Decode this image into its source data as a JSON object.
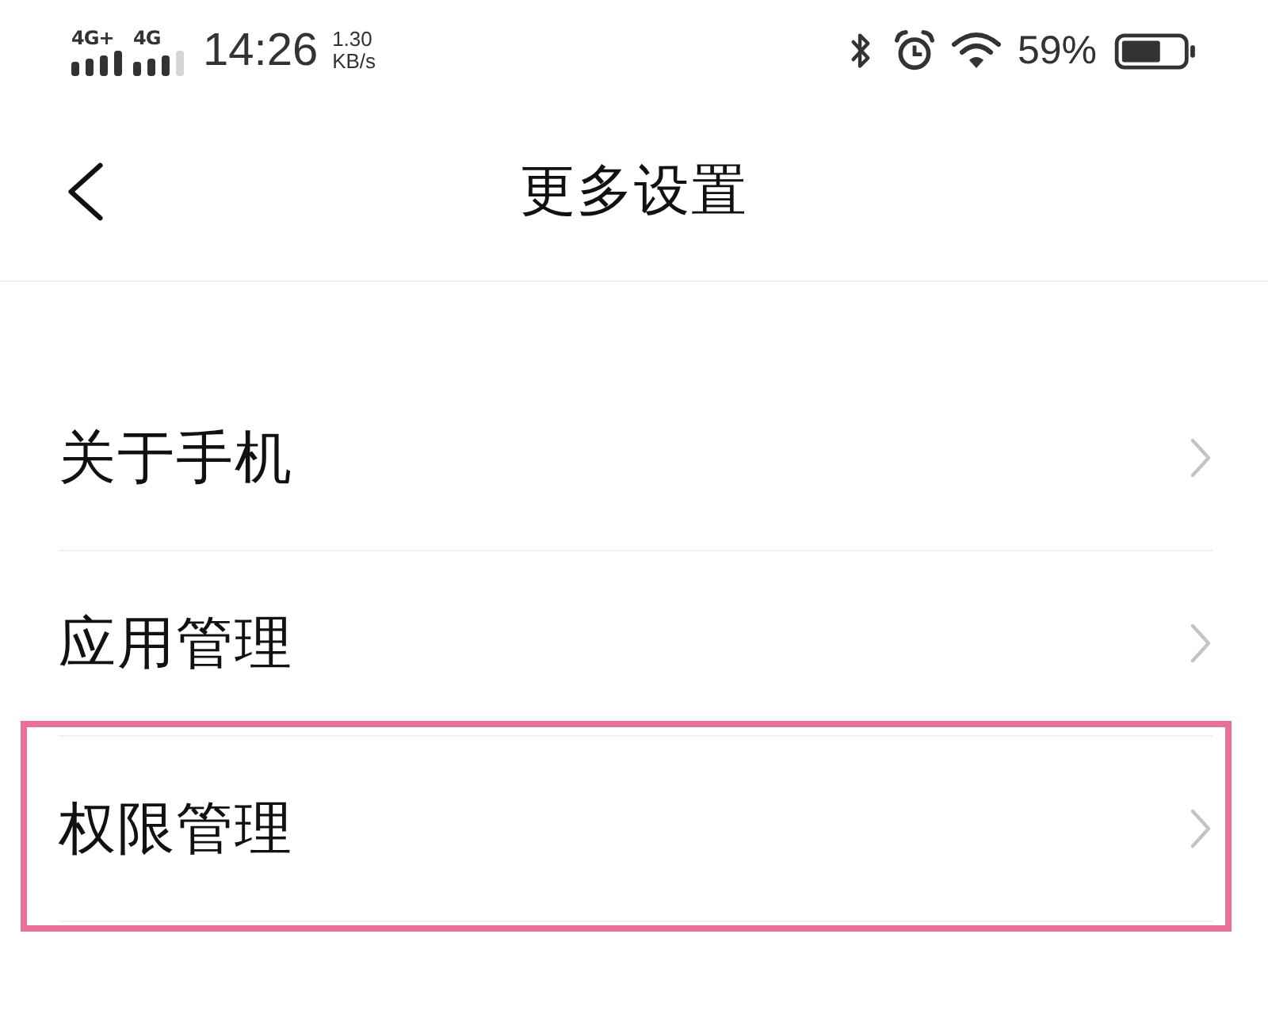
{
  "status_bar": {
    "networks": [
      {
        "label": "4G+"
      },
      {
        "label": "4G"
      }
    ],
    "time": "14:26",
    "speed": {
      "value": "1.30",
      "unit": "KB/s"
    },
    "battery_percent": "59%"
  },
  "header": {
    "title": "更多设置"
  },
  "items": [
    {
      "label": "关于手机",
      "highlighted": false
    },
    {
      "label": "应用管理",
      "highlighted": false
    },
    {
      "label": "权限管理",
      "highlighted": true
    }
  ]
}
